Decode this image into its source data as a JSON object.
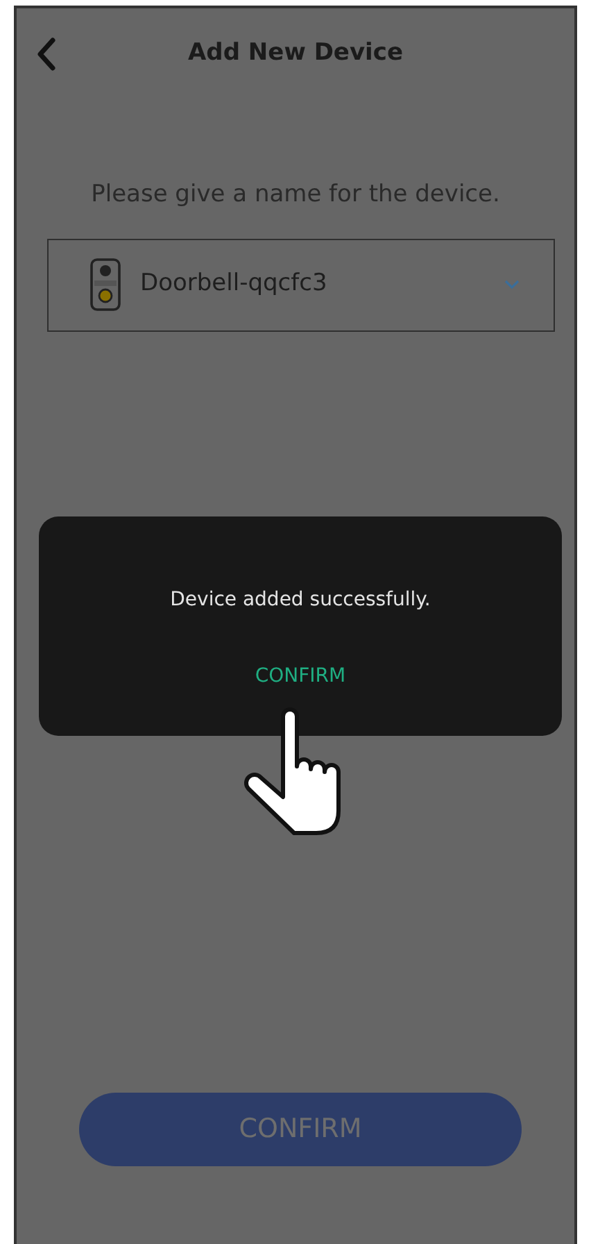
{
  "header": {
    "title": "Add New Device"
  },
  "prompt": "Please give a name for the device.",
  "device_field": {
    "value": "Doorbell-qqcfc3"
  },
  "dialog": {
    "message": "Device added successfully.",
    "button": "CONFIRM"
  },
  "bottom_button": {
    "label": "CONFIRM"
  }
}
